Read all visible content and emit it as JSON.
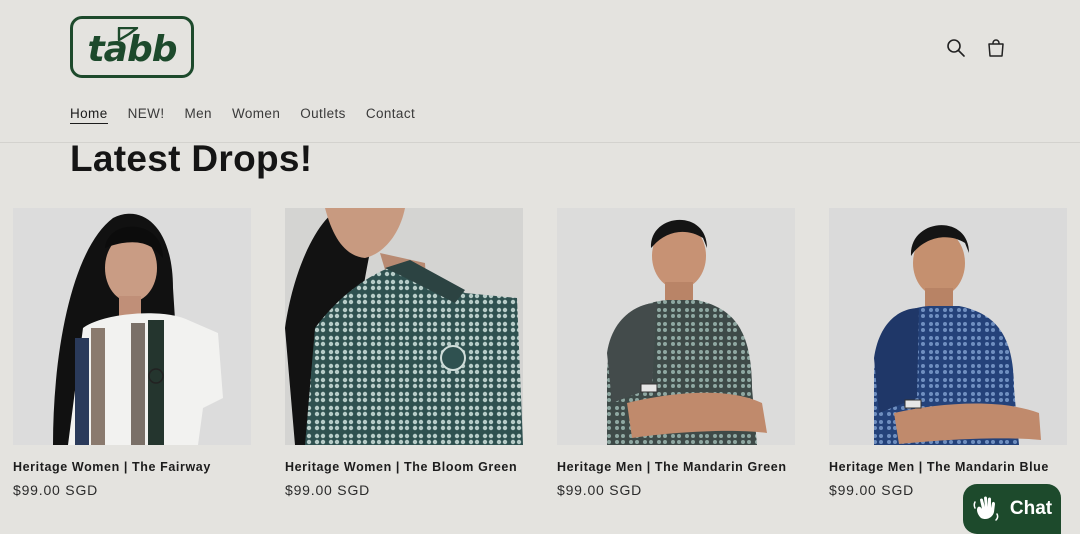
{
  "brand": {
    "logo_text": "tabb",
    "color": "#1d4a2c"
  },
  "header": {
    "icons": [
      "search-icon",
      "cart-icon"
    ]
  },
  "nav": [
    {
      "label": "Home",
      "active": true
    },
    {
      "label": "NEW!",
      "active": false
    },
    {
      "label": "Men",
      "active": false
    },
    {
      "label": "Women",
      "active": false
    },
    {
      "label": "Outlets",
      "active": false
    },
    {
      "label": "Contact",
      "active": false
    }
  ],
  "section": {
    "title": "Latest Drops!"
  },
  "products": [
    {
      "title": "Heritage Women | The Fairway",
      "price": "$99.00 SGD"
    },
    {
      "title": "Heritage Women | The Bloom Green",
      "price": "$99.00 SGD"
    },
    {
      "title": "Heritage Men | The Mandarin Green",
      "price": "$99.00 SGD"
    },
    {
      "title": "Heritage Men | The Mandarin Blue",
      "price": "$99.00 SGD"
    }
  ],
  "chat": {
    "label": "Chat",
    "icon": "waving-hand-icon"
  }
}
